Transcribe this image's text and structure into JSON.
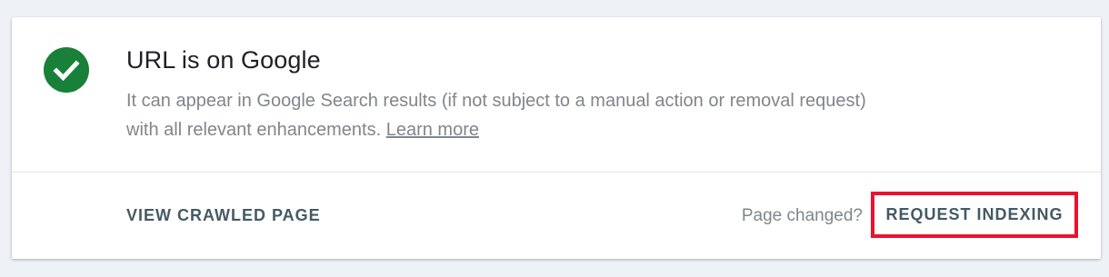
{
  "status": {
    "icon": "check-circle-icon",
    "icon_color": "#188038",
    "title": "URL is on Google",
    "description": "It can appear in Google Search results (if not subject to a manual action or removal request) with all relevant enhancements.",
    "learn_more_label": "Learn more"
  },
  "actions": {
    "view_crawled_label": "VIEW CRAWLED PAGE",
    "page_changed_text": "Page changed?",
    "request_indexing_label": "REQUEST INDEXING",
    "highlight_color": "#e8142e"
  }
}
